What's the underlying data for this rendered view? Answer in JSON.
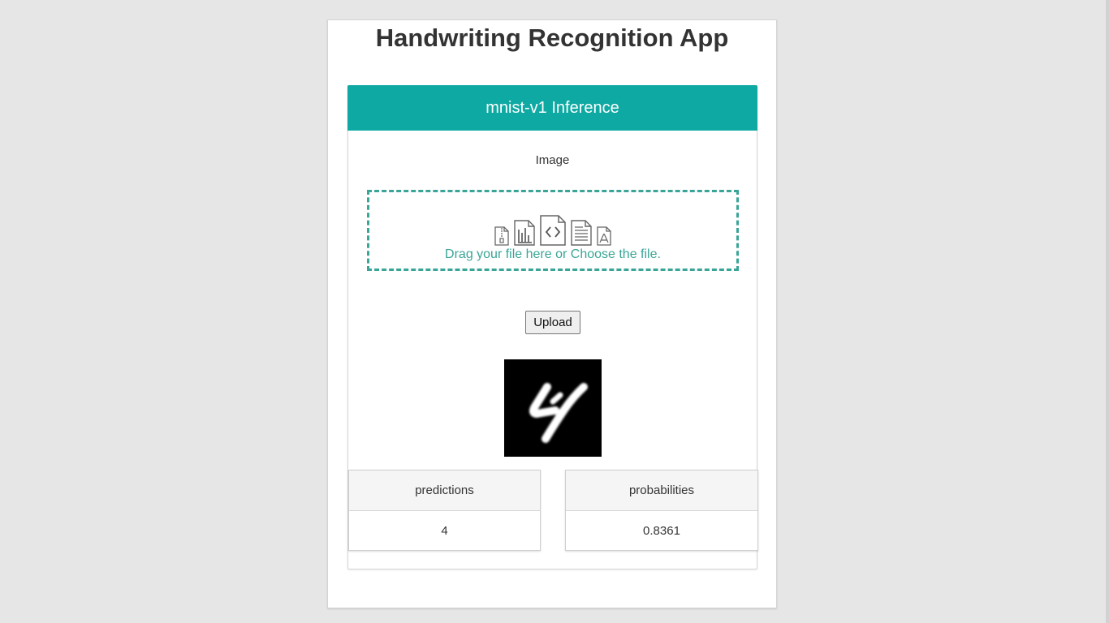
{
  "app": {
    "title": "Handwriting Recognition App"
  },
  "panel": {
    "header": "mnist-v1 Inference",
    "image_label": "Image",
    "dropzone": {
      "text": "Drag your file here or Choose the file.",
      "icons": [
        "zip-file-icon",
        "chart-file-icon",
        "code-file-icon",
        "text-file-icon",
        "pdf-file-icon"
      ]
    },
    "upload_label": "Upload",
    "preview": {
      "icon": "handwritten-digit-image",
      "digit": "4"
    },
    "results": [
      {
        "header": "predictions",
        "value": "4"
      },
      {
        "header": "probabilities",
        "value": "0.8361"
      }
    ]
  },
  "colors": {
    "accent": "#0ea9a2",
    "dropzone": "#3aa597",
    "background": "#e5e6e5"
  }
}
